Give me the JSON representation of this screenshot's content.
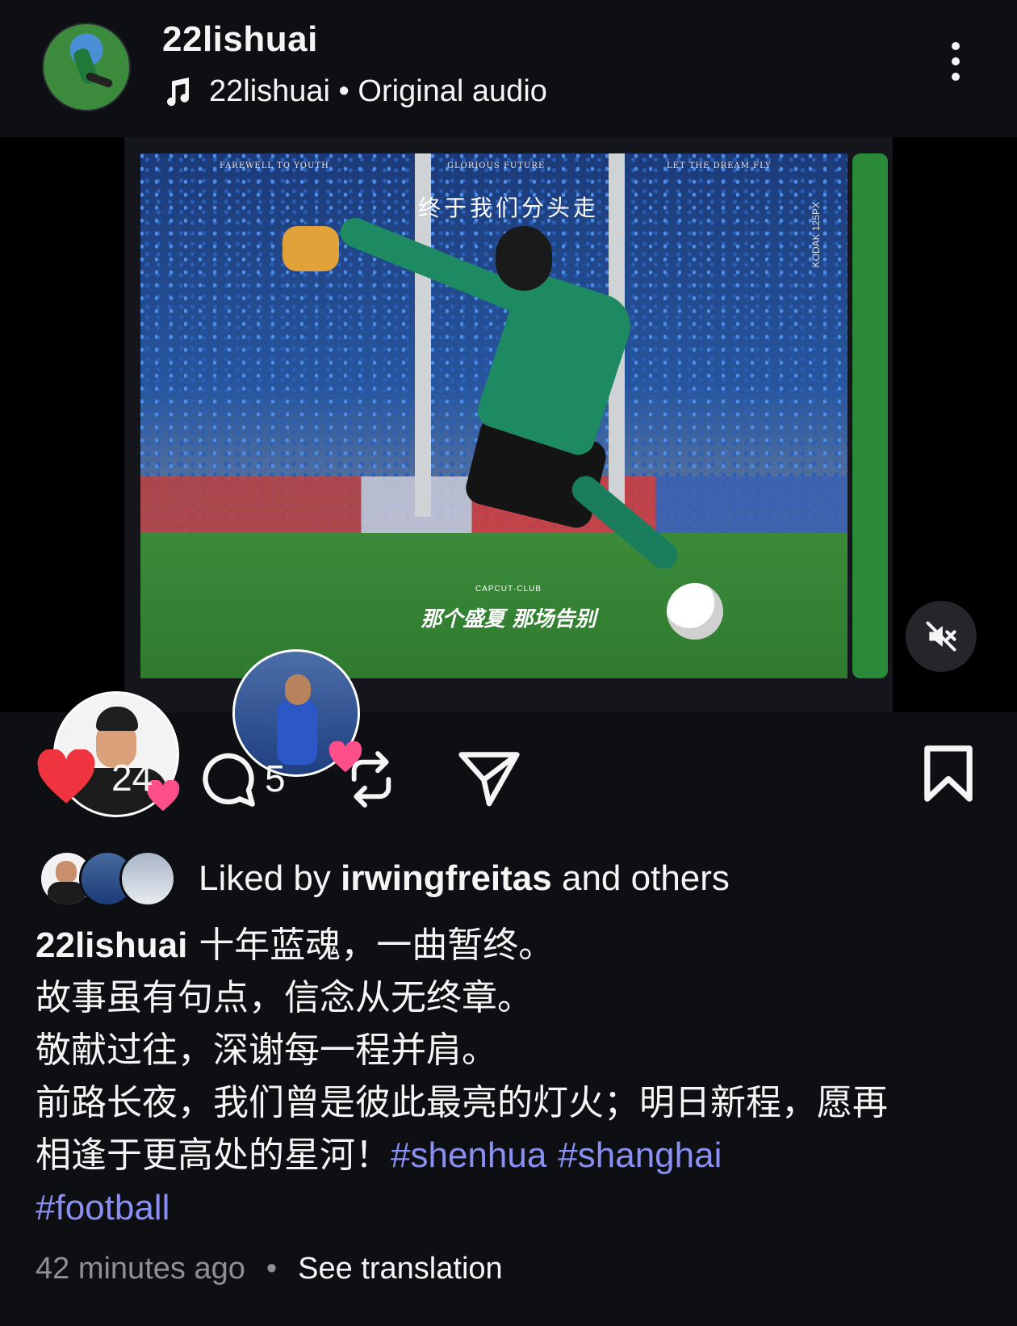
{
  "header": {
    "username": "22lishuai",
    "audio_label": "22lishuai • Original audio",
    "icons": {
      "music": "music-note-icon",
      "more": "more-vertical-icon"
    }
  },
  "media": {
    "poster_text": {
      "top_left": "FAREWELL TO YOUTH",
      "top_center": "GLORIOUS FUTURE",
      "top_right": "LET THE DREAM FLY",
      "title_cn": "终于我们分头走",
      "subtitle_cn": "那个盛夏 那场告别",
      "brand": "CAPCUT·CLUB",
      "side": "KODAK 125PX"
    },
    "mute_icon": "speaker-muted-icon"
  },
  "actions": {
    "likes": "24",
    "comments": "5",
    "colors": {
      "like": "#f0343f"
    }
  },
  "liked_by": {
    "prefix": "Liked by",
    "user": "irwingfreitas",
    "suffix": "and others"
  },
  "caption": {
    "user": "22lishuai",
    "line1": "十年蓝魂，一曲暂终。",
    "line2": "故事虽有句点，信念从无终章。",
    "line3": "敬献过往，深谢每一程并肩。",
    "line4": "前路长夜，我们曾是彼此最亮的灯火；明日新程，愿再",
    "line5": "相逢于更高处的星河！",
    "tags": [
      "#shenhua",
      "#shanghai",
      "#football"
    ],
    "tag_color": "#8a8ff2"
  },
  "meta": {
    "time": "42 minutes ago",
    "separator": "•",
    "translate": "See translation"
  }
}
